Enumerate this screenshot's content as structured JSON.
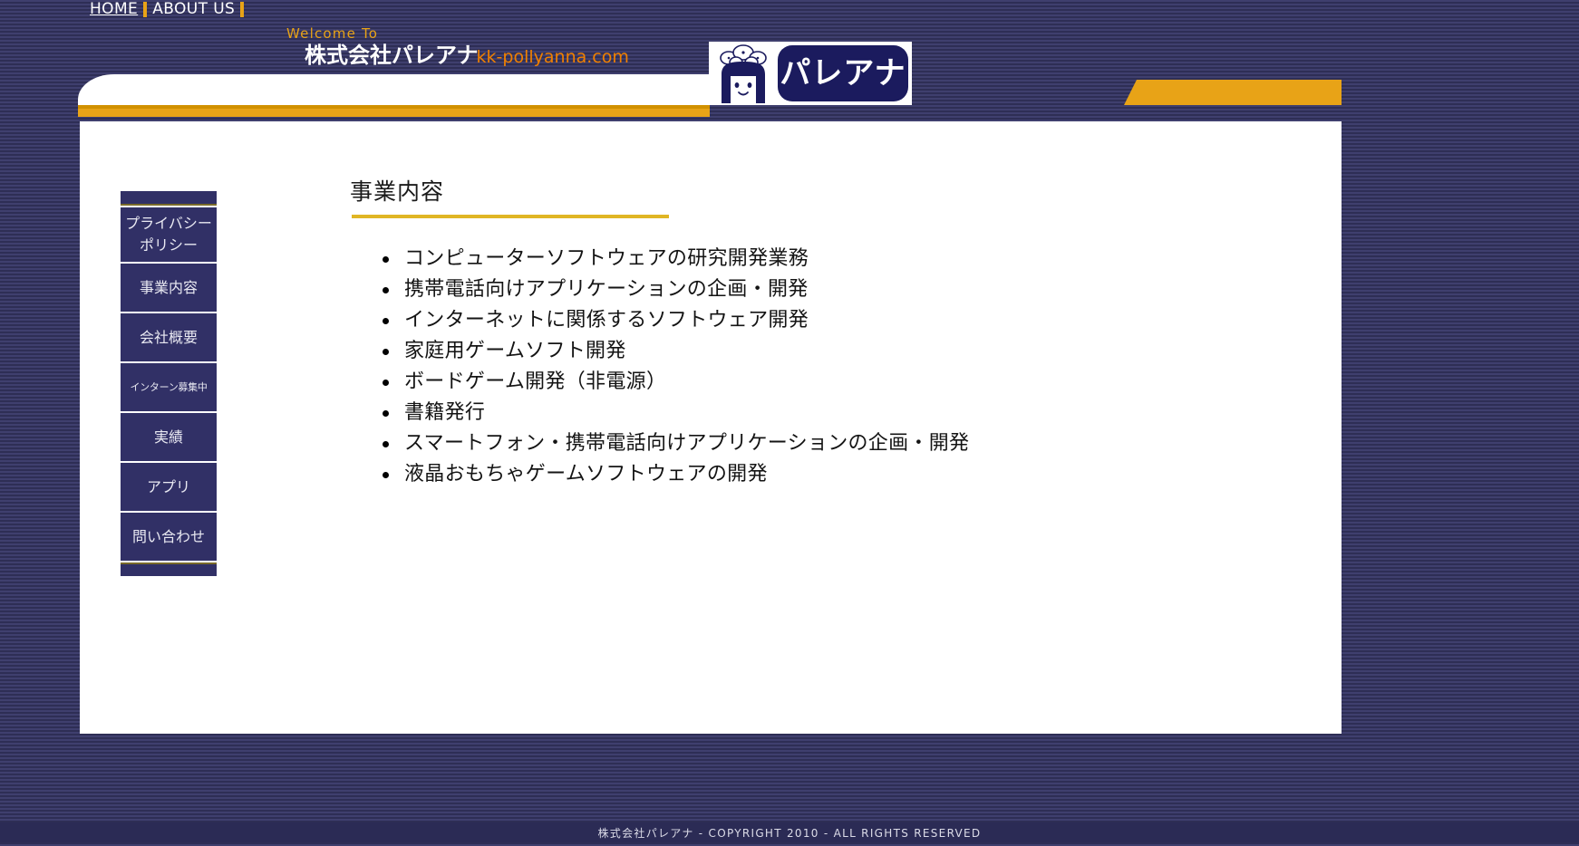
{
  "topnav": {
    "items": [
      {
        "label": "HOME",
        "underlined": true
      },
      {
        "label": "ABOUT US",
        "underlined": false
      }
    ],
    "separator_color": "#e8a317"
  },
  "header": {
    "welcome": "Welcome To",
    "brand_name": "株式会社パレアナ",
    "brand_url": "kk-pollyanna.com",
    "welcome_color": "#e8a317",
    "url_color": "#f08000"
  },
  "logo": {
    "mark_text": "パレアナ",
    "icon": "girl-with-flower-crown",
    "background": "#ffffff",
    "mark_background": "#1b1b5e"
  },
  "sidebar": {
    "items": [
      {
        "label": "プライバシーポリシー",
        "size": "two"
      },
      {
        "label": "事業内容",
        "size": "lg"
      },
      {
        "label": "会社概要",
        "size": "lg"
      },
      {
        "label": "インターン募集中",
        "size": "sm"
      },
      {
        "label": "実績",
        "size": "lg"
      },
      {
        "label": "アプリ",
        "size": "lg"
      },
      {
        "label": "問い合わせ",
        "size": "lg"
      }
    ],
    "background": "#313066"
  },
  "main": {
    "title": "事業内容",
    "rule_color": "#e0b624",
    "items": [
      "コンピューターソフトウェアの研究開発業務",
      "携帯電話向けアプリケーションの企画・開発",
      "インターネットに関係するソフトウェア開発",
      "家庭用ゲームソフト開発",
      "ボードゲーム開発（非電源）",
      "書籍発行",
      "スマートフォン・携帯電話向けアプリケーションの企画・開発",
      "液晶おもちゃゲームソフトウェアの開発"
    ]
  },
  "footer": {
    "text": "株式会社パレアナ - COPYRIGHT 2010 - ALL RIGHTS RESERVED"
  },
  "theme": {
    "page_background": "#3a3a66",
    "panel_background": "#ffffff",
    "accent_gold": "#e8a317",
    "navy": "#313066"
  }
}
